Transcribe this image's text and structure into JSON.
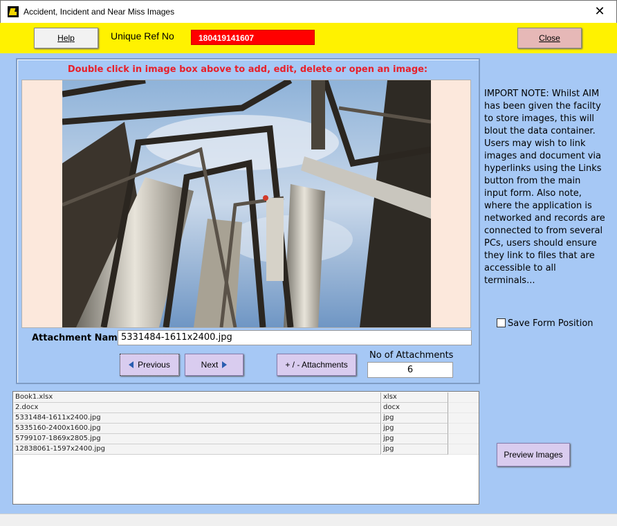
{
  "window": {
    "title": "Accident, Incident and Near Miss Images",
    "close_glyph": "✕"
  },
  "toolbar": {
    "help_label": "Help",
    "close_label": "Close",
    "ref_label": "Unique Ref No",
    "ref_value": "180419141607"
  },
  "main": {
    "instructions": "Double click in image box above to add, edit, delete or open an image:",
    "attachment_label": "Attachment Name:",
    "attachment_name": "5331484-1611x2400.jpg",
    "previous_label": "Previous",
    "next_label": "Next",
    "attachments_label": "+ / -  Attachments",
    "count_label": "No of Attachments",
    "count_value": "6"
  },
  "side": {
    "note": "IMPORT NOTE:  Whilst AIM has been given the facilty to store images, this will blout the data container. Users may wish to link images and document via hyperlinks using the Links button from the main input form.  Also note, where the application is networked and records are connected to from several PCs, users should ensure they link to files that are accessible to all terminals...",
    "save_position_label": "Save Form Position",
    "save_position_checked": false,
    "preview_label": "Preview Images"
  },
  "files": [
    {
      "name": "Book1.xlsx",
      "type": "xlsx"
    },
    {
      "name": "2.docx",
      "type": "docx"
    },
    {
      "name": "5331484-1611x2400.jpg",
      "type": "jpg"
    },
    {
      "name": "5335160-2400x1600.jpg",
      "type": "jpg"
    },
    {
      "name": "5799107-1869x2805.jpg",
      "type": "jpg"
    },
    {
      "name": "12838061-1597x2400.jpg",
      "type": "jpg"
    }
  ],
  "colors": {
    "form_background": "#a6c8f5",
    "header_bar": "#fff200",
    "ref_field": "#ff0000",
    "instructions_text": "#e8202a",
    "button_purple": "#d9ccef",
    "close_button": "#e6b8b7"
  }
}
